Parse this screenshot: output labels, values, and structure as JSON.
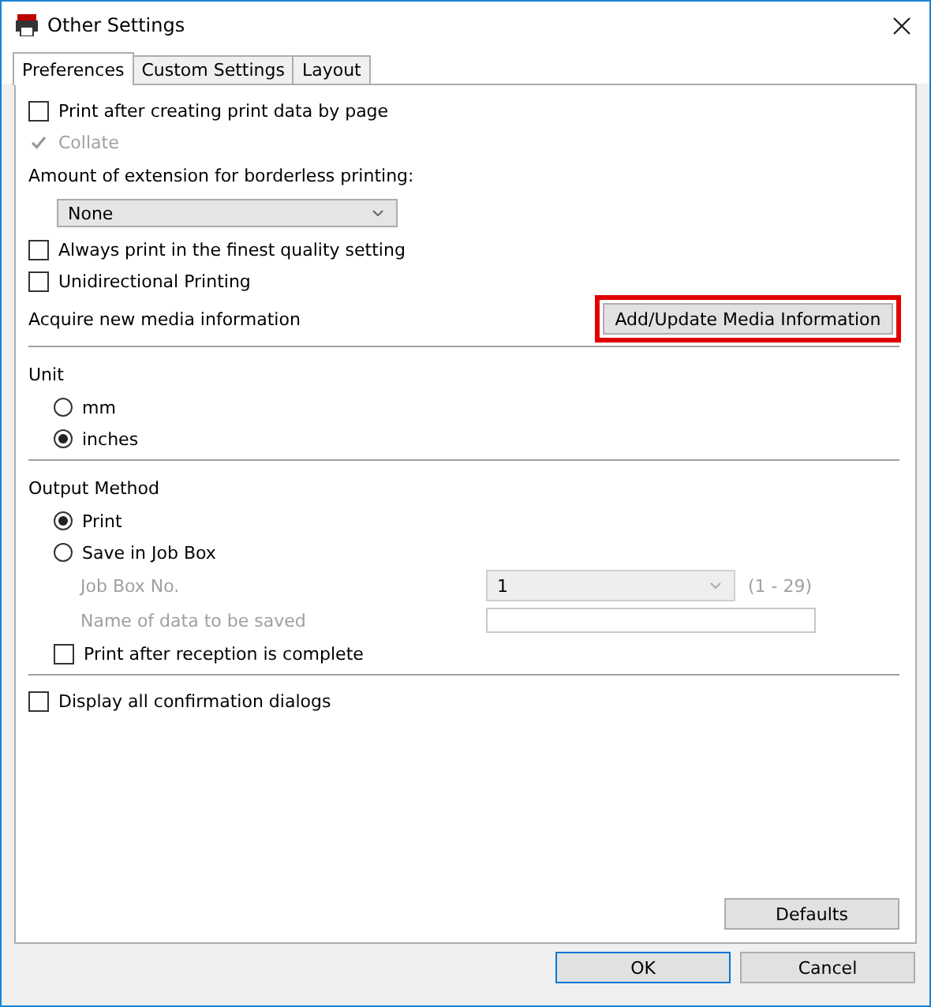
{
  "window": {
    "title": "Other Settings"
  },
  "tabs": [
    {
      "label": "Preferences",
      "selected": true
    },
    {
      "label": "Custom Settings",
      "selected": false
    },
    {
      "label": "Layout",
      "selected": false
    }
  ],
  "general": [
    {
      "kind": "checkbox",
      "label": "Print after creating print data by page",
      "checked": false,
      "disabled": false
    },
    {
      "kind": "checkbox",
      "label": "Collate",
      "checked": true,
      "disabled": true
    },
    {
      "kind": "label",
      "label": "Amount of extension for borderless printing:"
    },
    {
      "kind": "dropdown",
      "value": "None"
    },
    {
      "kind": "checkbox",
      "label": "Always print in the finest quality setting",
      "checked": false,
      "disabled": false
    },
    {
      "kind": "checkbox",
      "label": "Unidirectional Printing",
      "checked": false,
      "disabled": false
    }
  ],
  "acquire": {
    "label": "Acquire new media information",
    "button": "Add/Update Media Information",
    "highlighted": true
  },
  "unit": {
    "title": "Unit",
    "options": [
      {
        "label": "mm",
        "selected": false
      },
      {
        "label": "inches",
        "selected": true
      }
    ]
  },
  "output": {
    "title": "Output Method",
    "options": [
      {
        "label": "Print",
        "selected": true
      },
      {
        "label": "Save in Job Box",
        "selected": false
      }
    ],
    "job_box_no": {
      "label": "Job Box No.",
      "value": "1",
      "range": "(1 - 29)",
      "disabled": true
    },
    "data_name": {
      "label": "Name of data to be saved",
      "disabled": true
    },
    "print_after": {
      "label": "Print after reception is complete",
      "checked": false
    }
  },
  "confirm": {
    "label": "Display all confirmation dialogs",
    "checked": false
  },
  "defaults_button": "Defaults",
  "buttons": [
    {
      "label": "OK",
      "default": true
    },
    {
      "label": "Cancel",
      "default": false
    }
  ]
}
